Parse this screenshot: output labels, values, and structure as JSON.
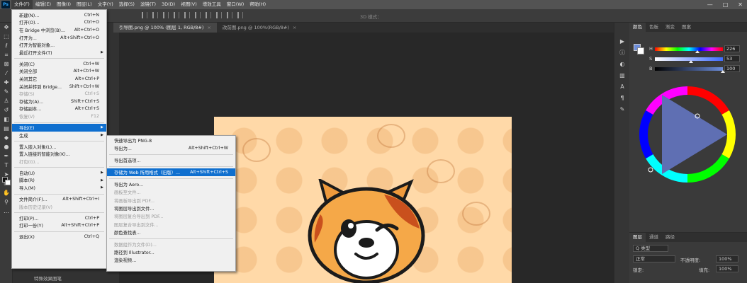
{
  "menubar": {
    "logo": "Ps",
    "items": [
      "文件(F)",
      "编辑(E)",
      "图像(I)",
      "图层(L)",
      "文字(Y)",
      "选择(S)",
      "滤镜(T)",
      "3D(D)",
      "视图(V)",
      "增效工具",
      "窗口(W)",
      "帮助(H)"
    ]
  },
  "window_controls": [
    "—",
    "□",
    "✕"
  ],
  "options_bar": {
    "mode_label": "3D 模式："
  },
  "tabs": [
    {
      "title": "引导图.png @ 100% (图层 1, RGB/8#)",
      "close": "×"
    },
    {
      "title": "改前图.png @ 100%(RGB/8#)",
      "close": "×"
    }
  ],
  "file_menu": {
    "items": [
      {
        "label": "新建(N)...",
        "shortcut": "Ctrl+N",
        "disabled": false
      },
      {
        "label": "打开(O)...",
        "shortcut": "Ctrl+O",
        "disabled": false
      },
      {
        "label": "在 Bridge 中浏览(B)...",
        "shortcut": "Alt+Ctrl+O",
        "disabled": false
      },
      {
        "label": "打开为...",
        "shortcut": "Alt+Shift+Ctrl+O",
        "disabled": false
      },
      {
        "label": "打开为智能对象...",
        "shortcut": "",
        "disabled": false
      },
      {
        "label": "最近打开文件(T)",
        "shortcut": "",
        "submenu": true,
        "disabled": false
      },
      {
        "sep": true
      },
      {
        "label": "关闭(C)",
        "shortcut": "Ctrl+W",
        "disabled": false
      },
      {
        "label": "关闭全部",
        "shortcut": "Alt+Ctrl+W",
        "disabled": false
      },
      {
        "label": "关闭其它",
        "shortcut": "Alt+Ctrl+P",
        "disabled": false
      },
      {
        "label": "关闭并转到 Bridge...",
        "shortcut": "Shift+Ctrl+W",
        "disabled": false
      },
      {
        "label": "存储(S)",
        "shortcut": "Ctrl+S",
        "disabled": true
      },
      {
        "label": "存储为(A)...",
        "shortcut": "Shift+Ctrl+S",
        "disabled": false
      },
      {
        "label": "存储副本...",
        "shortcut": "Alt+Ctrl+S",
        "disabled": false
      },
      {
        "label": "恢复(V)",
        "shortcut": "F12",
        "disabled": true
      },
      {
        "sep": true
      },
      {
        "label": "导出(E)",
        "shortcut": "",
        "submenu": true,
        "highlight": true,
        "disabled": false
      },
      {
        "label": "生成",
        "shortcut": "",
        "submenu": true,
        "disabled": false
      },
      {
        "sep": true
      },
      {
        "label": "置入嵌入对象(L)...",
        "shortcut": "",
        "disabled": false
      },
      {
        "label": "置入链接的智能对象(K)...",
        "shortcut": "",
        "disabled": false
      },
      {
        "label": "打包(G)...",
        "shortcut": "",
        "disabled": true
      },
      {
        "sep": true
      },
      {
        "label": "自动(U)",
        "shortcut": "",
        "submenu": true,
        "disabled": false
      },
      {
        "label": "脚本(R)",
        "shortcut": "",
        "submenu": true,
        "disabled": false
      },
      {
        "label": "导入(M)",
        "shortcut": "",
        "submenu": true,
        "disabled": false
      },
      {
        "sep": true
      },
      {
        "label": "文件简介(F)...",
        "shortcut": "Alt+Shift+Ctrl+I",
        "disabled": false
      },
      {
        "label": "版本历史记录(V)",
        "shortcut": "",
        "disabled": true
      },
      {
        "sep": true
      },
      {
        "label": "打印(P)...",
        "shortcut": "Ctrl+P",
        "disabled": false
      },
      {
        "label": "打印一份(Y)",
        "shortcut": "Alt+Shift+Ctrl+P",
        "disabled": false
      },
      {
        "sep": true
      },
      {
        "label": "退出(X)",
        "shortcut": "Ctrl+Q",
        "disabled": false
      }
    ]
  },
  "export_menu": {
    "items": [
      {
        "label": "快速导出为 PNG-8",
        "shortcut": "",
        "disabled": false
      },
      {
        "label": "导出为...",
        "shortcut": "Alt+Shift+Ctrl+W",
        "disabled": false
      },
      {
        "sep": true
      },
      {
        "label": "导出首选项...",
        "shortcut": "",
        "disabled": false
      },
      {
        "sep": true
      },
      {
        "label": "存储为 Web 所用格式（旧版）...",
        "shortcut": "Alt+Shift+Ctrl+S",
        "highlight": true,
        "disabled": false
      },
      {
        "sep": true
      },
      {
        "label": "导出为 Aero...",
        "shortcut": "",
        "disabled": false
      },
      {
        "label": "画板至文件...",
        "shortcut": "",
        "disabled": true
      },
      {
        "label": "将画板导出到 PDF...",
        "shortcut": "",
        "disabled": true
      },
      {
        "label": "将图层导出到文件...",
        "shortcut": "",
        "disabled": false
      },
      {
        "label": "将图层复合导出到 PDF...",
        "shortcut": "",
        "disabled": true
      },
      {
        "label": "图层复合导出到文件...",
        "shortcut": "",
        "disabled": true
      },
      {
        "label": "颜色查找表...",
        "shortcut": "",
        "disabled": false
      },
      {
        "sep": true
      },
      {
        "label": "数据组作为文件(D)...",
        "shortcut": "",
        "disabled": true
      },
      {
        "label": "路径到 Illustrator...",
        "shortcut": "",
        "disabled": false
      },
      {
        "label": "渲染视频...",
        "shortcut": "",
        "disabled": false
      }
    ]
  },
  "left_panel": {
    "rows": [
      "特殊效果图笔"
    ]
  },
  "color_panel": {
    "tabs": [
      "颜色",
      "色板",
      "渐变",
      "图案"
    ],
    "sliders": [
      {
        "label": "H",
        "value": "226",
        "pos": 0.63
      },
      {
        "label": "S",
        "value": "53",
        "pos": 0.53
      },
      {
        "label": "B",
        "value": "100",
        "pos": 1.0
      }
    ],
    "fg_color": "#6c8ddb"
  },
  "layers_panel": {
    "tabs": [
      "图层",
      "通道",
      "路径"
    ],
    "kind_label": "Q 类型",
    "blend_mode": "正常",
    "opacity_label": "不透明度:",
    "opacity_value": "100%",
    "lock_label": "锁定:",
    "fill_label": "填充:",
    "fill_value": "100%"
  },
  "colors": {
    "menu_highlight": "#0f6fcf",
    "canvas_bg": "#ffd9a8",
    "app_bg": "#282828"
  }
}
